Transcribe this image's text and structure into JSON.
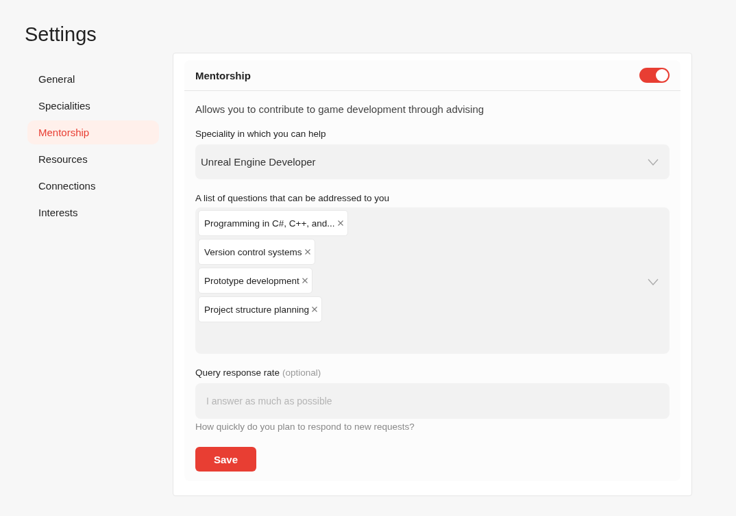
{
  "page": {
    "title": "Settings"
  },
  "sidebar": {
    "items": [
      {
        "label": "General",
        "selected": false
      },
      {
        "label": "Specialities",
        "selected": false
      },
      {
        "label": "Mentorship",
        "selected": true
      },
      {
        "label": "Resources",
        "selected": false
      },
      {
        "label": "Connections",
        "selected": false
      },
      {
        "label": "Interests",
        "selected": false
      }
    ]
  },
  "section": {
    "title": "Mentorship",
    "on": true,
    "description": "Allows you to contribute to game development through advising",
    "speciality": {
      "label": "Speciality in which you can help",
      "value": "Unreal Engine Developer"
    },
    "questions": {
      "label": "A list of questions that can be addressed to you",
      "tags": [
        {
          "label": "Programming in C#, C++, and..."
        },
        {
          "label": "Version control systems"
        },
        {
          "label": "Prototype development"
        },
        {
          "label": "Project structure planning"
        }
      ]
    },
    "response_rate": {
      "label": "Query response rate",
      "note": "(optional)",
      "placeholder": "I answer as much as possible",
      "hint": "How quickly do you plan to respond to new requests?"
    },
    "save_button": "Save"
  }
}
